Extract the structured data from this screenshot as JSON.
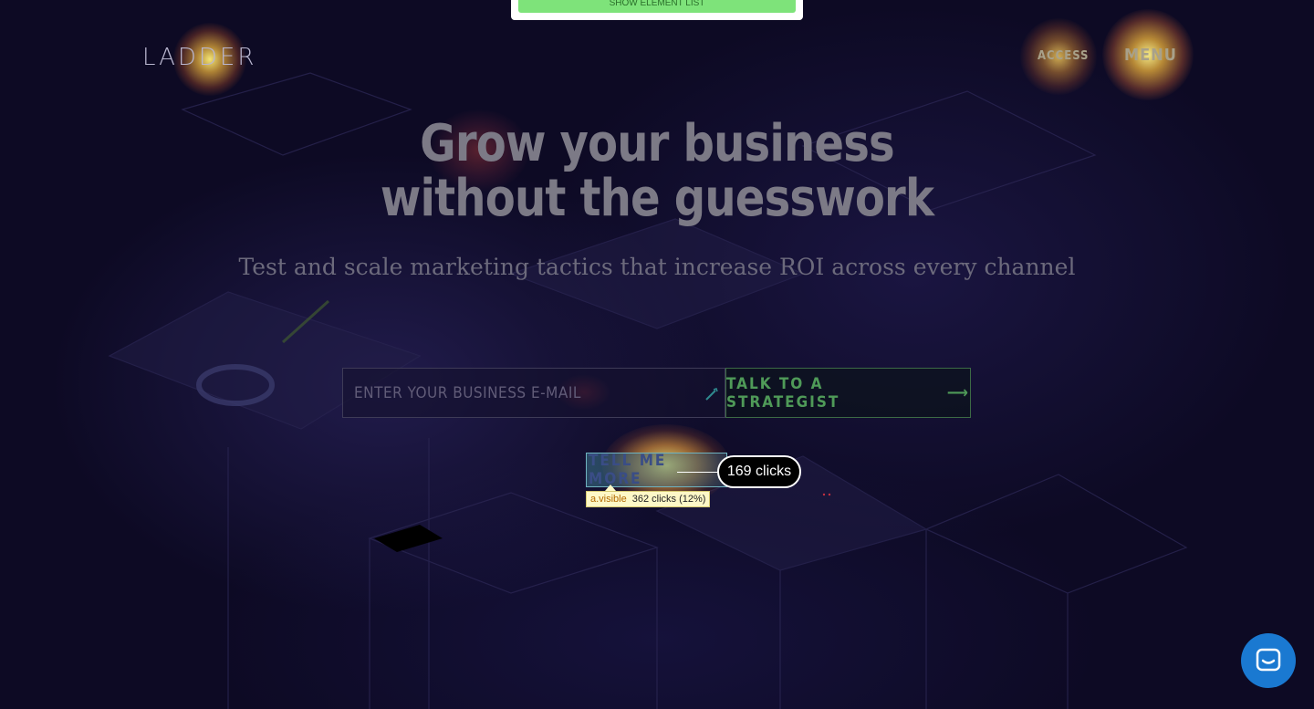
{
  "toolbar": {
    "show_elements_label": "SHOW ELEMENT LIST"
  },
  "header": {
    "logo": "LADDER",
    "access_label": "ACCESS",
    "menu_label": "MENU"
  },
  "hero": {
    "title_line1": "Grow your business",
    "title_line2": "without the guesswork",
    "subtitle": "Test and scale marketing tactics that increase ROI across every channel"
  },
  "form": {
    "email_placeholder": "ENTER YOUR BUSINESS E-MAIL",
    "cta_label": "TALK TO A STRATEGIST",
    "arrow": "⟶"
  },
  "secondary": {
    "tell_more_label": "TELL ME MORE"
  },
  "heatmap": {
    "bubble_label": "169 clicks",
    "tooltip_selector": "a.visible",
    "tooltip_stats": "362 clicks (12%)"
  },
  "colors": {
    "background": "#0d0a24",
    "cta_green": "#4f9a58",
    "chat_blue": "#1a79d1"
  }
}
